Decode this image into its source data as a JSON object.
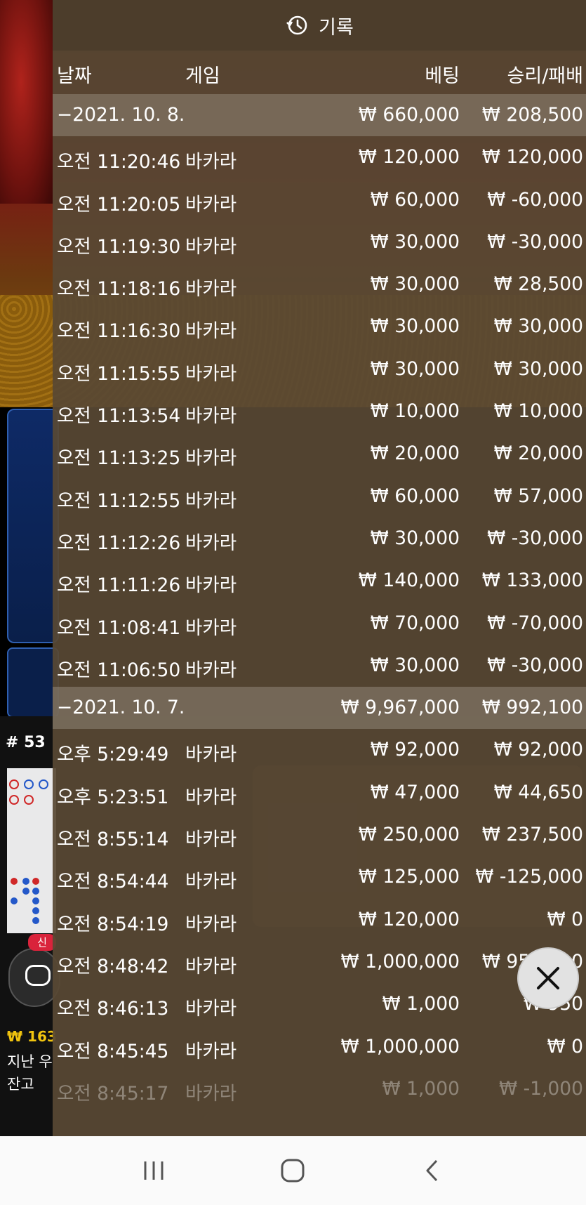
{
  "header": {
    "title": "기록",
    "icon": "history-icon"
  },
  "columns": {
    "date": "날짜",
    "game": "게임",
    "bet": "베팅",
    "win": "승리/패배"
  },
  "rows": [
    {
      "type": "group",
      "date": "−2021. 10. 8.",
      "game": "",
      "bet": "₩ 660,000",
      "win": "₩ 208,500"
    },
    {
      "type": "item",
      "date": "오전 11:20:46",
      "game": "바카라",
      "bet": "₩ 120,000",
      "win": "₩ 120,000"
    },
    {
      "type": "item",
      "date": "오전 11:20:05",
      "game": "바카라",
      "bet": "₩ 60,000",
      "win": "₩ -60,000"
    },
    {
      "type": "item",
      "date": "오전 11:19:30",
      "game": "바카라",
      "bet": "₩ 30,000",
      "win": "₩ -30,000"
    },
    {
      "type": "item",
      "date": "오전 11:18:16",
      "game": "바카라",
      "bet": "₩ 30,000",
      "win": "₩ 28,500"
    },
    {
      "type": "item",
      "date": "오전 11:16:30",
      "game": "바카라",
      "bet": "₩ 30,000",
      "win": "₩ 30,000"
    },
    {
      "type": "item",
      "date": "오전 11:15:55",
      "game": "바카라",
      "bet": "₩ 30,000",
      "win": "₩ 30,000"
    },
    {
      "type": "item",
      "date": "오전 11:13:54",
      "game": "바카라",
      "bet": "₩ 10,000",
      "win": "₩ 10,000"
    },
    {
      "type": "item",
      "date": "오전 11:13:25",
      "game": "바카라",
      "bet": "₩ 20,000",
      "win": "₩ 20,000"
    },
    {
      "type": "item",
      "date": "오전 11:12:55",
      "game": "바카라",
      "bet": "₩ 60,000",
      "win": "₩ 57,000"
    },
    {
      "type": "item",
      "date": "오전 11:12:26",
      "game": "바카라",
      "bet": "₩ 30,000",
      "win": "₩ -30,000"
    },
    {
      "type": "item",
      "date": "오전 11:11:26",
      "game": "바카라",
      "bet": "₩ 140,000",
      "win": "₩ 133,000"
    },
    {
      "type": "item",
      "date": "오전 11:08:41",
      "game": "바카라",
      "bet": "₩ 70,000",
      "win": "₩ -70,000"
    },
    {
      "type": "item",
      "date": "오전 11:06:50",
      "game": "바카라",
      "bet": "₩ 30,000",
      "win": "₩ -30,000"
    },
    {
      "type": "group",
      "date": "−2021. 10. 7.",
      "game": "",
      "bet": "₩ 9,967,000",
      "win": "₩ 992,100"
    },
    {
      "type": "item",
      "date": "오후 5:29:49",
      "game": "바카라",
      "bet": "₩ 92,000",
      "win": "₩ 92,000"
    },
    {
      "type": "item",
      "date": "오후 5:23:51",
      "game": "바카라",
      "bet": "₩ 47,000",
      "win": "₩ 44,650"
    },
    {
      "type": "item",
      "date": "오전 8:55:14",
      "game": "바카라",
      "bet": "₩ 250,000",
      "win": "₩ 237,500"
    },
    {
      "type": "item",
      "date": "오전 8:54:44",
      "game": "바카라",
      "bet": "₩ 125,000",
      "win": "₩ -125,000"
    },
    {
      "type": "item",
      "date": "오전 8:54:19",
      "game": "바카라",
      "bet": "₩ 120,000",
      "win": "₩ 0"
    },
    {
      "type": "item",
      "date": "오전 8:48:42",
      "game": "바카라",
      "bet": "₩ 1,000,000",
      "win": "₩ 950,000"
    },
    {
      "type": "item",
      "date": "오전 8:46:13",
      "game": "바카라",
      "bet": "₩ 1,000",
      "win": "₩ 950"
    },
    {
      "type": "item",
      "date": "오전 8:45:45",
      "game": "바카라",
      "bet": "₩ 1,000,000",
      "win": "₩ 0"
    },
    {
      "type": "item",
      "faded": true,
      "date": "오전 8:45:17",
      "game": "바카라",
      "bet": "₩ 1,000",
      "win": "₩ -1,000"
    }
  ],
  "background": {
    "round_number": "# 53",
    "new_badge": "신",
    "balance_amount": "₩ 163",
    "last_label": "지난 우",
    "remain_label": "잔고"
  },
  "close_button": {
    "icon": "close-icon"
  },
  "navbar": {
    "icons": [
      "recent-apps-icon",
      "home-icon",
      "back-icon"
    ]
  },
  "colors": {
    "overlay": "#584834",
    "group_row": "#968c7d",
    "balance": "#f1c40f",
    "close_bg": "#e2e2e2"
  }
}
